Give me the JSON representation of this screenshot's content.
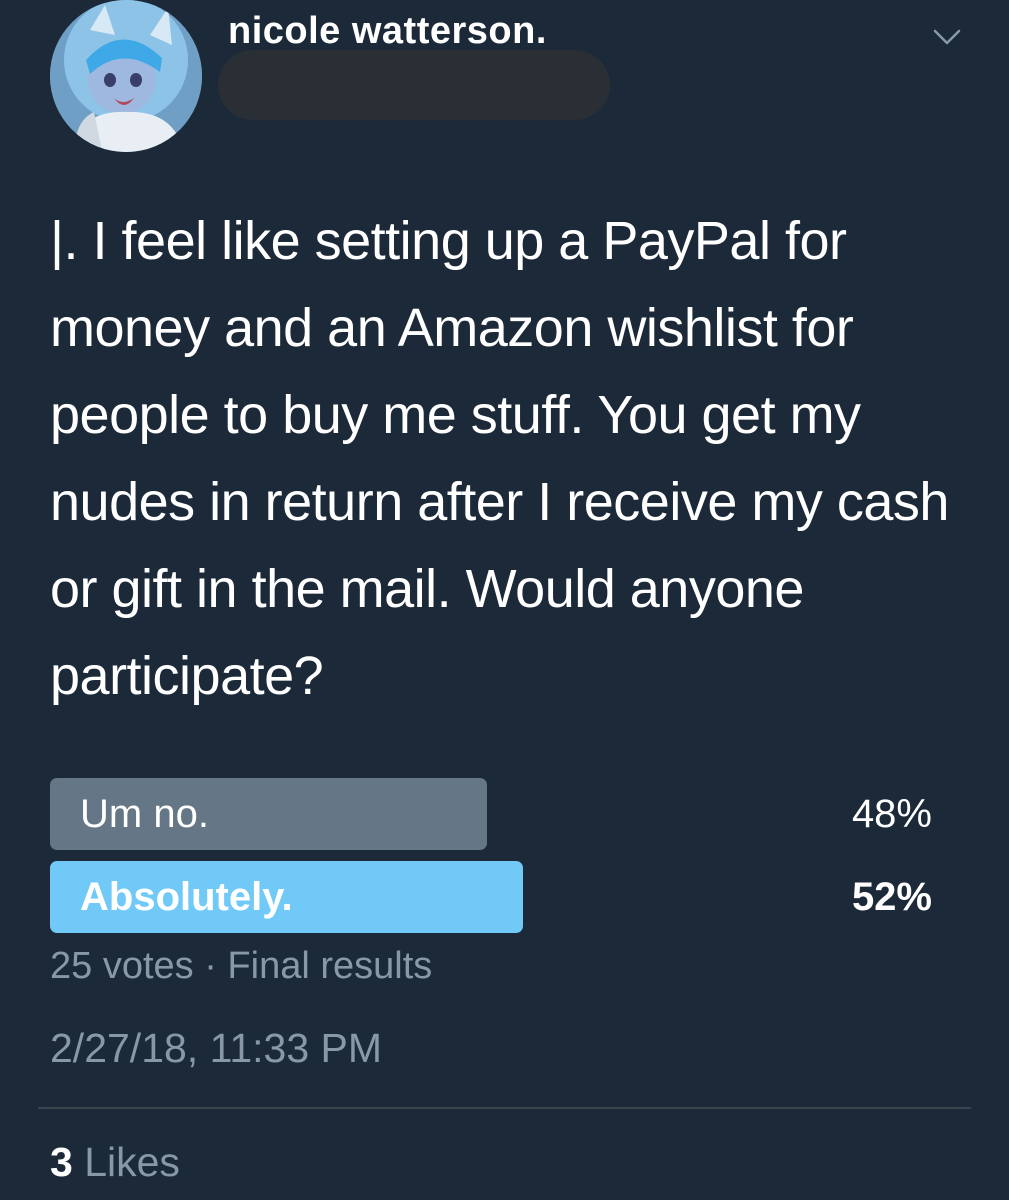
{
  "author": {
    "display_name": "nicole watterson.",
    "avatar_icon": "avatar-cartoon-character-icon"
  },
  "tweet": {
    "text": "|. I feel like setting up a PayPal for money and an Amazon wishlist for people to buy me stuff. You get my nudes in return after I receive my cash or gift in the mail. Would anyone participate?"
  },
  "poll": {
    "options": [
      {
        "label": "Um no.",
        "percent_text": "48%",
        "share": 0.48,
        "winner": false
      },
      {
        "label": "Absolutely.",
        "percent_text": "52%",
        "share": 0.52,
        "winner": true
      }
    ],
    "summary": "25 votes · Final results"
  },
  "timestamp": "2/27/18, 11:33 PM",
  "likes": {
    "count": "3",
    "label": "Likes"
  },
  "colors": {
    "background": "#1c2938",
    "poll_loser": "#657786",
    "poll_winner": "#71c9f8",
    "muted_text": "#8899a6"
  }
}
